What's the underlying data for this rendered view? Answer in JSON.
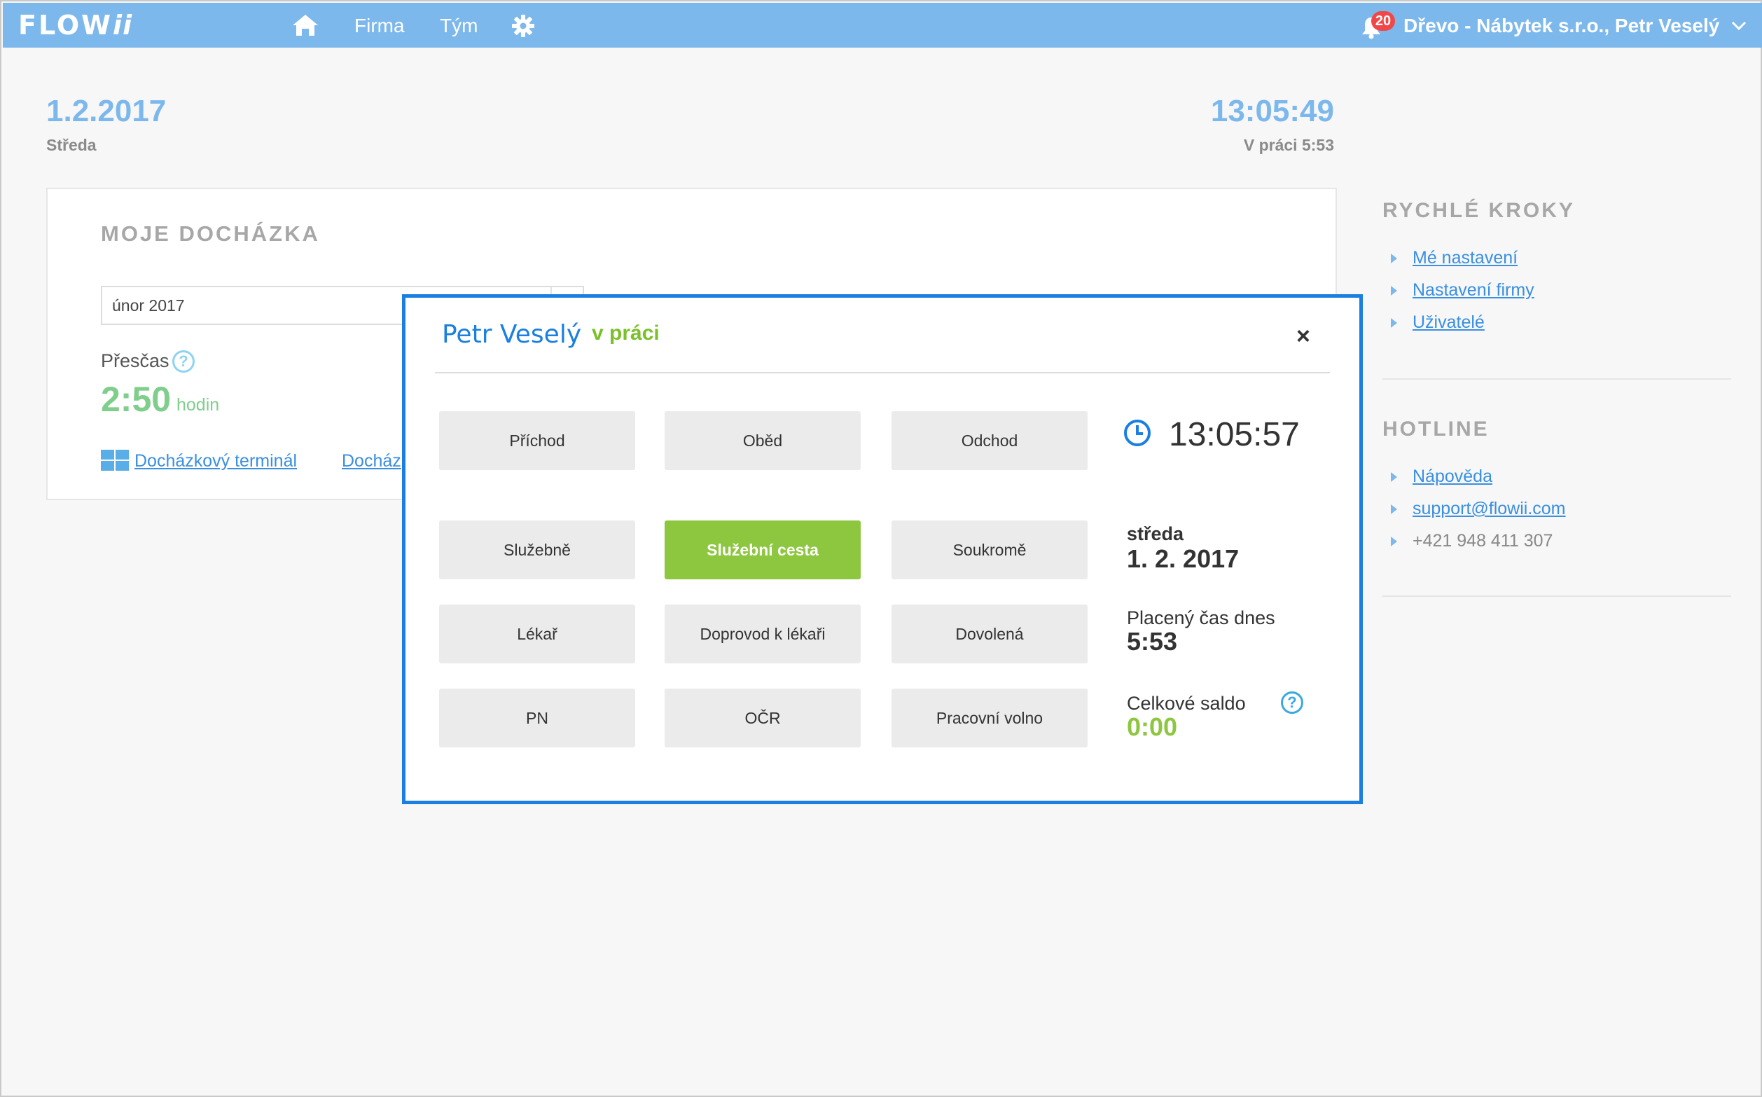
{
  "app": {
    "logo_main": "FLOW",
    "logo_suffix": "ii",
    "nav": {
      "firma": "Firma",
      "tym": "Tým"
    },
    "notifications_count": "20",
    "company_user": "Dřevo - Nábytek s.r.o., Petr Veselý"
  },
  "header": {
    "date": "1.2.2017",
    "weekday": "Středa",
    "time": "13:05:49",
    "at_work": "V práci 5:53"
  },
  "attendance": {
    "title": "MOJE DOCHÁZKA",
    "month_value": "únor 2017",
    "overtime_label": "Přesčas",
    "overtime_value": "2:50",
    "overtime_unit": "hodin",
    "terminal_link": "Docházkový terminál",
    "second_link": "Docház"
  },
  "sidebar": {
    "quick_title": "RYCHLÉ KROKY",
    "quick_items": [
      "Mé nastavení",
      "Nastavení firmy",
      "Uživatelé"
    ],
    "hotline_title": "HOTLINE",
    "hotline_items": [
      "Nápověda",
      "support@flowii.com",
      "+421 948 411 307"
    ]
  },
  "modal": {
    "user_name": "Petr Veselý",
    "status": "v práci",
    "close": "×",
    "buttons": {
      "prichod": "Příchod",
      "obed": "Oběd",
      "odchod": "Odchod",
      "sluzebne": "Služebně",
      "sluzebni_cesta": "Služební cesta",
      "soukrome": "Soukromě",
      "lekar": "Lékař",
      "doprovod": "Doprovod k lékaři",
      "dovolena": "Dovolená",
      "pn": "PN",
      "ocr": "OČR",
      "pracovni_volno": "Pracovní volno"
    },
    "active_button": "Služební cesta",
    "clock": "13:05:57",
    "day_name": "středa",
    "day_date": "1. 2. 2017",
    "paid_label": "Placený čas dnes",
    "paid_value": "5:53",
    "balance_label": "Celkové saldo",
    "balance_value": "0:00",
    "help": "?"
  },
  "colors": {
    "topbar": "#7db8ec",
    "modal_border": "#1a7fe0",
    "active_button": "#8dc63f",
    "link": "#3a8fe0",
    "overtime": "#7fce8c"
  },
  "icons": [
    "home-icon",
    "gear-icon",
    "bell-icon",
    "chevron-down-icon",
    "windows-icon",
    "help-icon",
    "clock-icon",
    "close-icon",
    "arrow-right-icon"
  ]
}
